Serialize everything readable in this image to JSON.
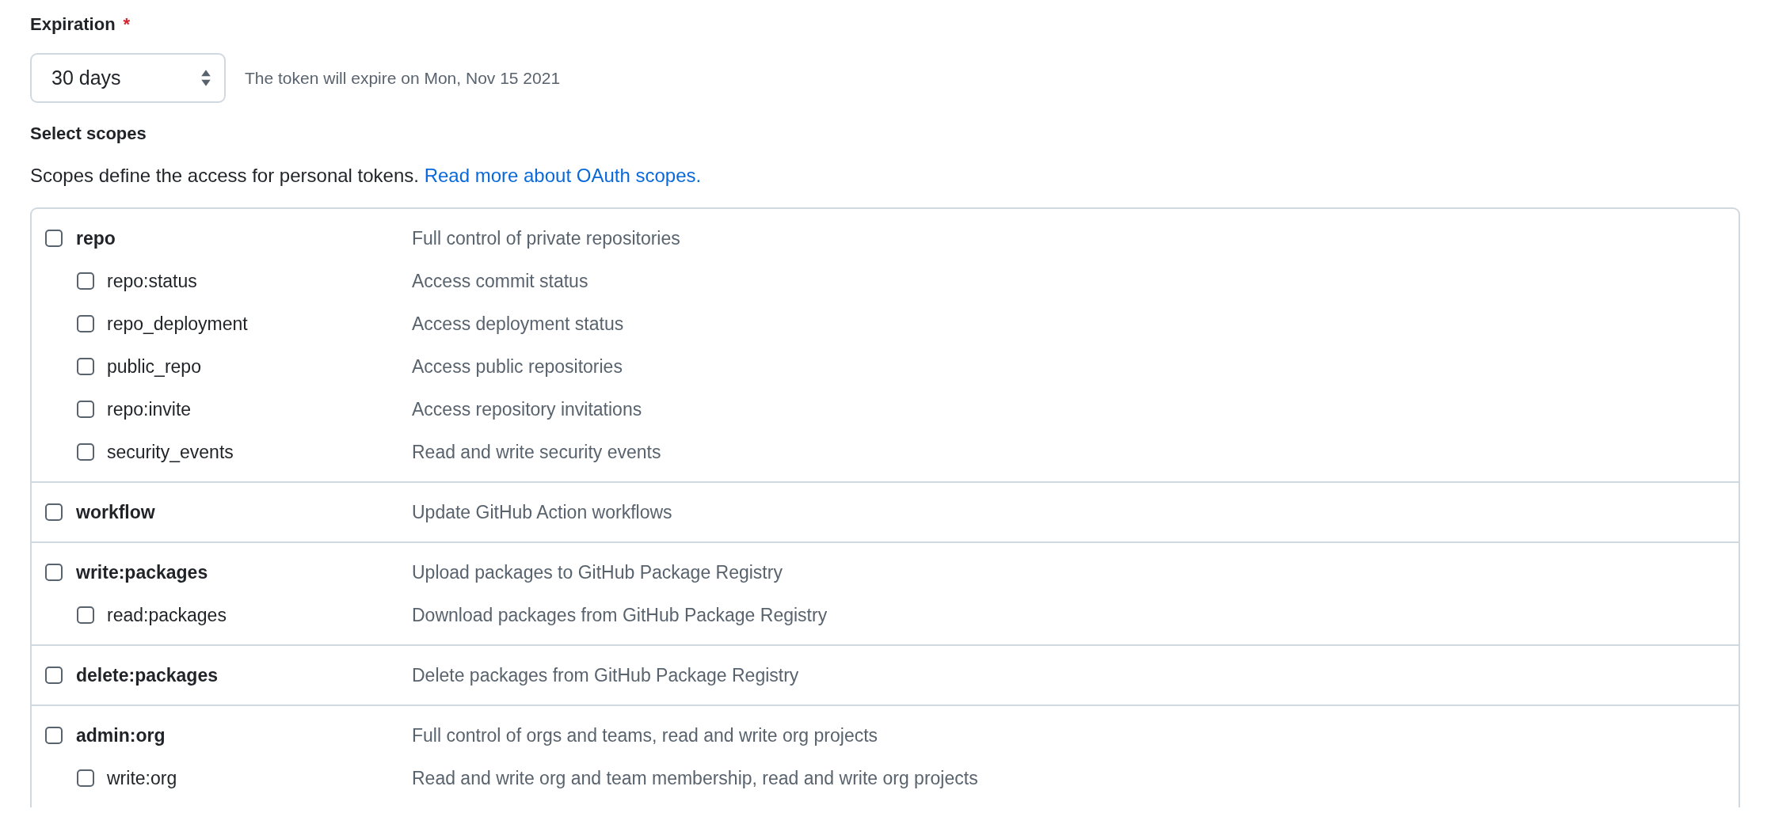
{
  "expiration": {
    "label": "Expiration",
    "required_mark": "*",
    "select": {
      "value": "30 days"
    },
    "note": "The token will expire on Mon, Nov 15 2021"
  },
  "scopes": {
    "title": "Select scopes",
    "description": "Scopes define the access for personal tokens.",
    "link": "Read more about OAuth scopes."
  },
  "scope_groups": [
    {
      "name": "repo",
      "description": "Full control of private repositories",
      "checked": false,
      "children": [
        {
          "name": "repo:status",
          "description": "Access commit status",
          "checked": false
        },
        {
          "name": "repo_deployment",
          "description": "Access deployment status",
          "checked": false
        },
        {
          "name": "public_repo",
          "description": "Access public repositories",
          "checked": false
        },
        {
          "name": "repo:invite",
          "description": "Access repository invitations",
          "checked": false
        },
        {
          "name": "security_events",
          "description": "Read and write security events",
          "checked": false
        }
      ]
    },
    {
      "name": "workflow",
      "description": "Update GitHub Action workflows",
      "checked": false
    },
    {
      "name": "write:packages",
      "description": "Upload packages to GitHub Package Registry",
      "checked": false,
      "children": [
        {
          "name": "read:packages",
          "description": "Download packages from GitHub Package Registry",
          "checked": false
        }
      ]
    },
    {
      "name": "delete:packages",
      "description": "Delete packages from GitHub Package Registry",
      "checked": false
    },
    {
      "name": "admin:org",
      "description": "Full control of orgs and teams, read and write org projects",
      "checked": false,
      "children": [
        {
          "name": "write:org",
          "description": "Read and write org and team membership, read and write org projects",
          "checked": false
        }
      ]
    }
  ]
}
